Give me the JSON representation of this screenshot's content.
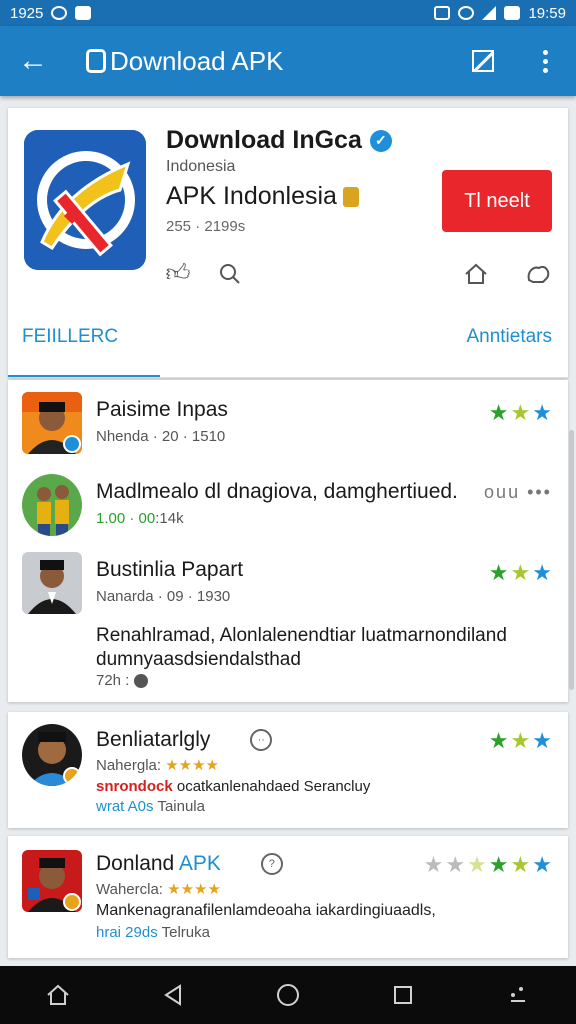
{
  "status_bar": {
    "time_left": "1925",
    "time_right": "19:59"
  },
  "app_bar": {
    "title": "Download APK"
  },
  "app": {
    "name": "Download InGca",
    "subtitle": "Indonesia",
    "name2": "APK Indonlesia",
    "meta": "255 · 2199s",
    "install_label": "Tl neelt"
  },
  "tabs": [
    {
      "label": "FEIILLERC",
      "active": true
    },
    {
      "label": "Anntietars",
      "active": false
    }
  ],
  "list": [
    {
      "title": "Paisime Inpas",
      "meta": "Nhenda · 20 · 1510",
      "stars": [
        "g",
        "y",
        "b"
      ]
    },
    {
      "title": "Madlmealo dl dnagiova, damghertiued.",
      "meta_green": "1.00 · 00",
      "meta_rest": ":14k",
      "right_text": "ouu  •••"
    },
    {
      "title": "Bustinlia Papart",
      "meta": "Nanarda · 09 · 1930",
      "stars": [
        "g",
        "y",
        "b"
      ]
    }
  ],
  "paragraph": {
    "line1": "Renahlramad, Alonlalenendtiar luatmarnondiland",
    "line2": "dumnyaasdsiendalsthad",
    "time": "72h :"
  },
  "reviews": [
    {
      "title": "Benliatarlgly",
      "label": "Nahergla:",
      "stars_text": "★★★★",
      "red_text": "snrondock",
      "body": "ocatkanlenahdaed Serancluy",
      "blue_text": "wrat A0s",
      "tail": "Tainula",
      "right_stars": [
        "g",
        "y",
        "b"
      ]
    },
    {
      "title": "Donland",
      "title_accent": "APK",
      "label": "Wahercla:",
      "stars_text": "★★★★",
      "body": "Mankenagranafilenlamdeoaha iakardingiuaadls,",
      "blue_text": "hrai 29ds",
      "tail": "Telruka",
      "right_stars": [
        "grey",
        "grey",
        "y",
        "g",
        "y",
        "b"
      ]
    }
  ]
}
